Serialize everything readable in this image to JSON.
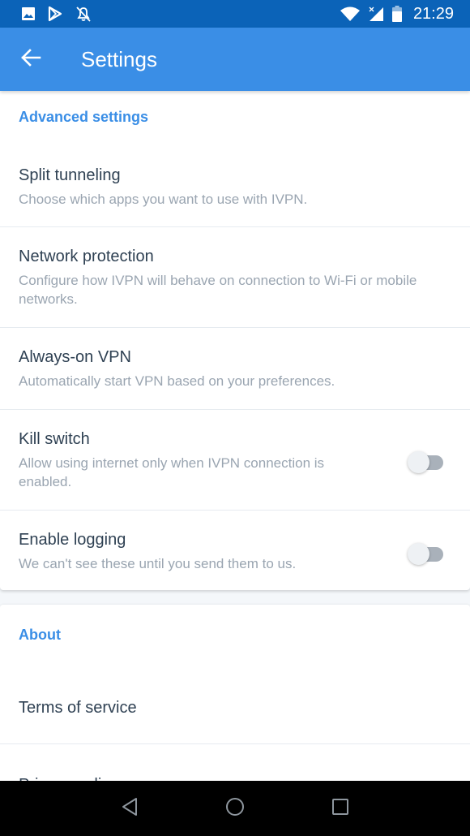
{
  "status_bar": {
    "left_icons": [
      "image-icon",
      "play-store-icon",
      "notifications-off-icon"
    ],
    "right_icons": [
      "wifi-icon",
      "cellular-no-data-icon",
      "battery-icon"
    ],
    "time": "21:29"
  },
  "app_bar": {
    "back_icon": "arrow-left-icon",
    "title": "Settings"
  },
  "colors": {
    "status_bar": "#0b63b8",
    "app_bar": "#3a8ee6",
    "accent": "#3a8ee6",
    "title_text": "#2f4153",
    "secondary_text": "#9aa5b1",
    "toggle_track_off": "#a9b1ba",
    "toggle_thumb_off": "#eef1f4"
  },
  "advanced": {
    "header": "Advanced settings",
    "items": [
      {
        "title": "Split tunneling",
        "description": "Choose which apps you want to use with IVPN."
      },
      {
        "title": "Network protection",
        "description": "Configure how IVPN will behave on connection to Wi-Fi or mobile networks."
      },
      {
        "title": "Always-on VPN",
        "description": "Automatically start VPN based on your preferences."
      },
      {
        "title": "Kill switch",
        "description": "Allow using internet only when IVPN connection is enabled.",
        "toggle": false
      },
      {
        "title": "Enable logging",
        "description": "We can't see these until you send them to us.",
        "toggle": false
      }
    ]
  },
  "about": {
    "header": "About",
    "items": [
      {
        "title": "Terms of service"
      },
      {
        "title": "Privacy policy"
      }
    ]
  },
  "nav_bar": {
    "buttons": [
      "back-triangle-icon",
      "home-circle-icon",
      "recents-square-icon"
    ]
  }
}
